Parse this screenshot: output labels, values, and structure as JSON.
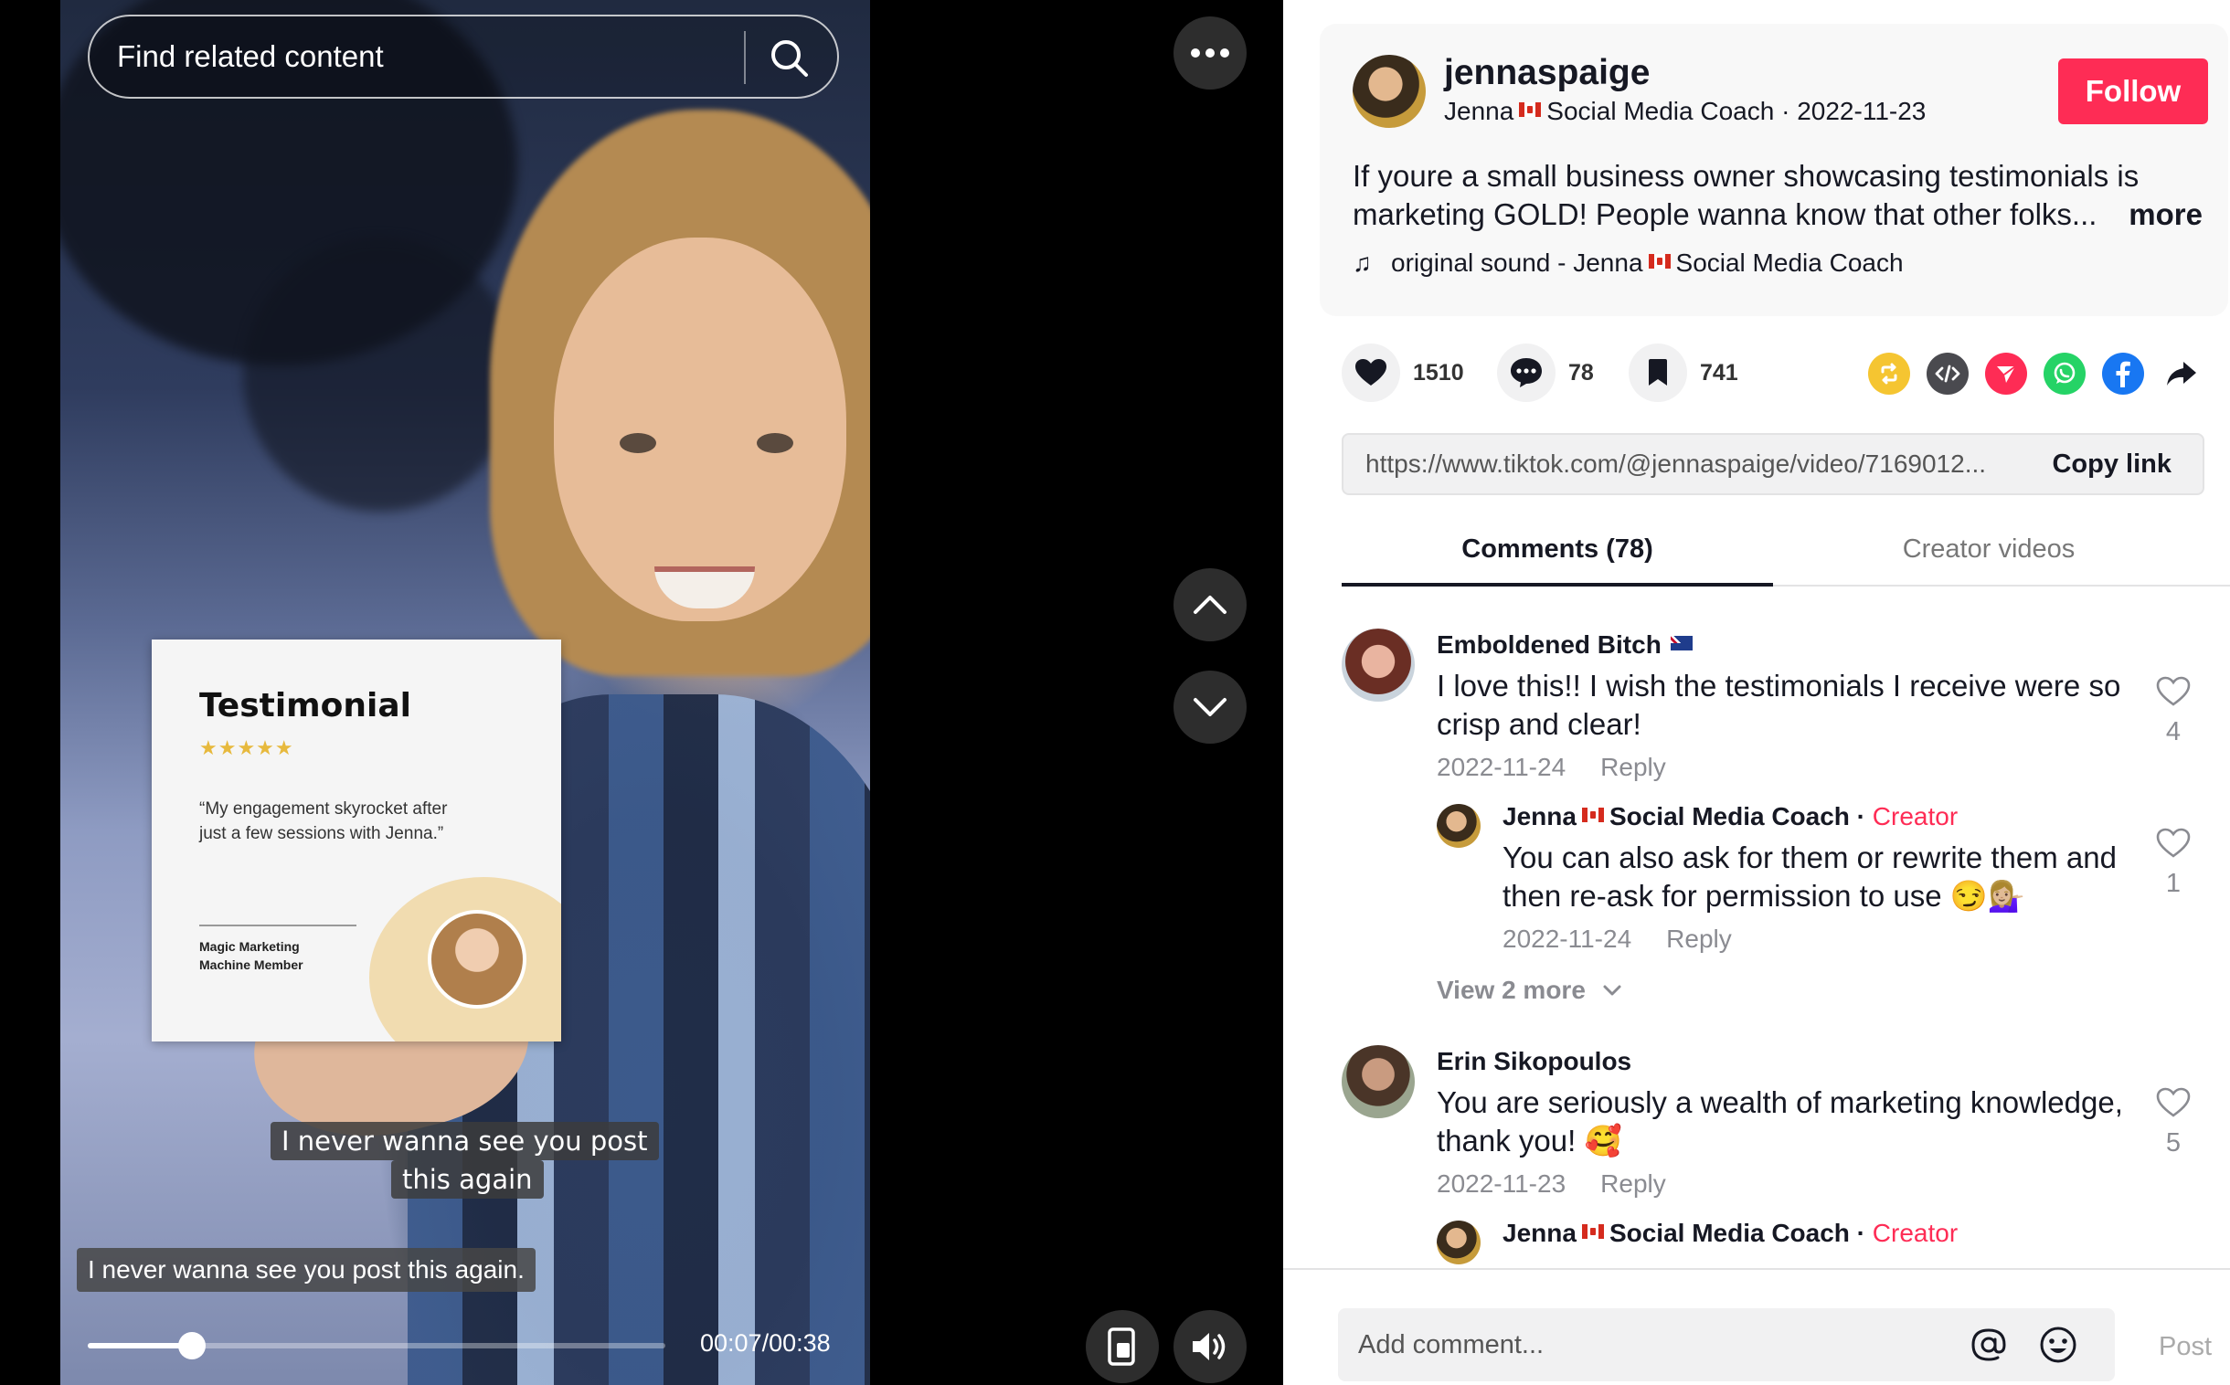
{
  "video": {
    "search_placeholder": "Find related content",
    "testimonial": {
      "title": "Testimonial",
      "stars": "★★★★★",
      "quote": "“My engagement skyrocket after just a few sessions with Jenna.”",
      "member": "Magic Marketing Machine Member"
    },
    "sticker_line1": "I never wanna see you post",
    "sticker_line2": "this again",
    "subtitle": "I never wanna see you post this again.",
    "progress": 0.18,
    "time": "00:07/00:38"
  },
  "author": {
    "username": "jennaspaige",
    "nickname_part1": "Jenna",
    "nickname_part2": "Social Media Coach",
    "date": "2022-11-23",
    "follow_label": "Follow"
  },
  "description": "If youre a small business owner showcasing testimonials is marketing GOLD! People wanna know that other folks...",
  "description_more": "more",
  "sound": {
    "icon": "music-note-icon",
    "part1": "original sound - Jenna",
    "part2": "Social Media Coach"
  },
  "stats": {
    "likes": "1510",
    "comments": "78",
    "saves": "741"
  },
  "share_colors": {
    "repost": "#f5c531",
    "embed": "#4a4a4f",
    "send": "#fe2c55",
    "whatsapp": "#25d366",
    "facebook": "#1877f2"
  },
  "link": {
    "url": "https://www.tiktok.com/@jennaspaige/video/7169012...",
    "copy_label": "Copy link"
  },
  "tabs": {
    "comments": "Comments (78)",
    "creator_videos": "Creator videos"
  },
  "comments": [
    {
      "name": "Emboldened Bitch",
      "text": "I love this!! I wish the testimonials I receive were so crisp and clear!",
      "date": "2022-11-24",
      "reply": "Reply",
      "likes": "4"
    },
    {
      "name_part1": "Jenna",
      "name_part2": "Social Media Coach",
      "creator": "Creator",
      "text": "You can also ask for them or rewrite them and then re-ask for permission to use 😏💁🏼‍♀️",
      "date": "2022-11-24",
      "reply": "Reply",
      "likes": "1"
    },
    {
      "name": "Erin Sikopoulos",
      "text": "You are seriously a wealth of marketing knowledge, thank you! 🥰",
      "date": "2022-11-23",
      "reply": "Reply",
      "likes": "5"
    },
    {
      "name_part1": "Jenna",
      "name_part2": "Social Media Coach",
      "creator": "Creator"
    }
  ],
  "view_more": "View 2 more",
  "add_comment": {
    "placeholder": "Add comment...",
    "post_label": "Post"
  }
}
